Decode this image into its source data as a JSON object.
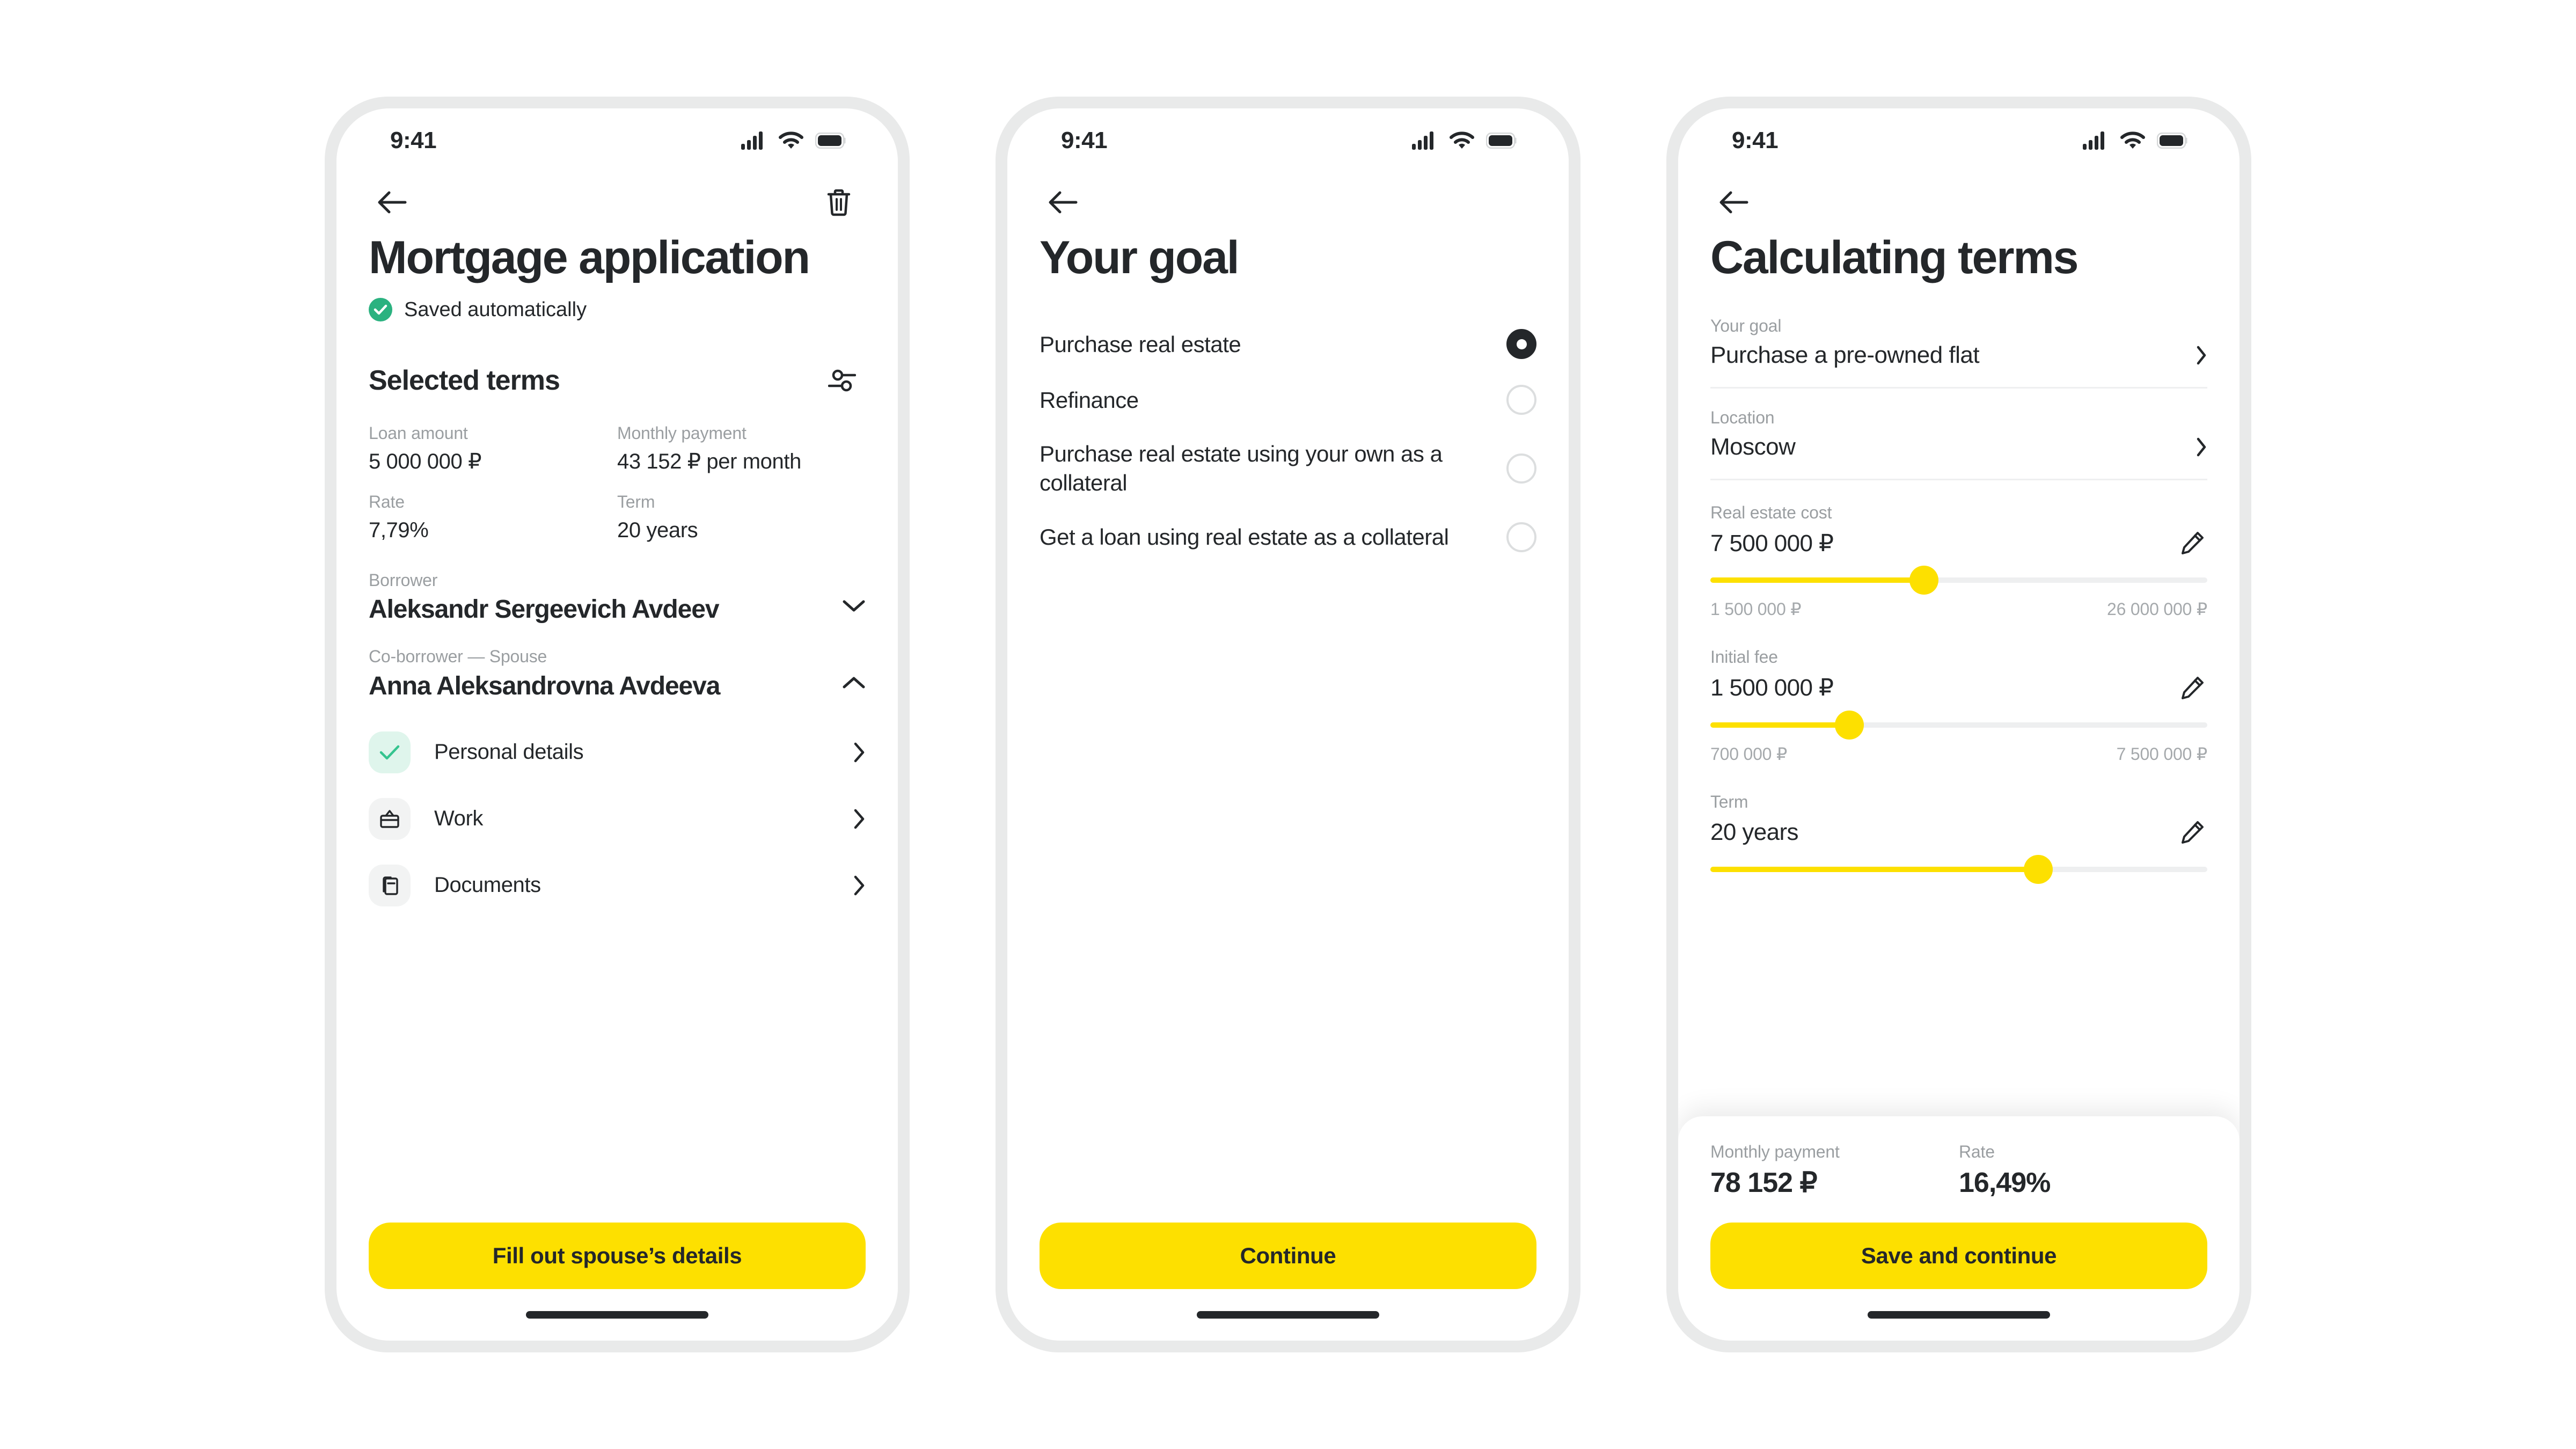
{
  "status_bar": {
    "time": "9:41",
    "icons": [
      "cellular-signal-icon",
      "wifi-icon",
      "battery-icon"
    ]
  },
  "colors": {
    "accent_yellow": "#FDE000",
    "text_dark": "#24272A",
    "text_muted": "#9A9EA1",
    "success_green": "#2BB280",
    "success_green_bg": "#DFF5EC",
    "divider": "#EEEFF0",
    "phone_frame": "#E9EAEA"
  },
  "screen1": {
    "title": "Mortgage application",
    "saved_text": "Saved automatically",
    "section_title": "Selected terms",
    "terms": [
      {
        "label": "Loan amount",
        "value": "5 000 000 ₽"
      },
      {
        "label": "Monthly payment",
        "value": "43 152 ₽ per month"
      },
      {
        "label": "Rate",
        "value": "7,79%"
      },
      {
        "label": "Term",
        "value": "20 years"
      }
    ],
    "borrower": {
      "label": "Borrower",
      "name": "Aleksandr Sergeevich Avdeev",
      "state": "collapsed"
    },
    "coborrower": {
      "label": "Co-borrower — Spouse",
      "name": "Anna Aleksandrovna Avdeeva",
      "state": "expanded"
    },
    "tasks": [
      {
        "label": "Personal details",
        "icon": "check-icon",
        "done": true
      },
      {
        "label": "Work",
        "icon": "briefcase-icon",
        "done": false
      },
      {
        "label": "Documents",
        "icon": "documents-icon",
        "done": false
      }
    ],
    "cta": "Fill out spouse’s details",
    "nav": {
      "back": "back-arrow-icon",
      "delete": "trash-icon",
      "filter": "sliders-icon"
    }
  },
  "screen2": {
    "title": "Your goal",
    "options": [
      {
        "label": "Purchase real estate",
        "selected": true
      },
      {
        "label": "Refinance",
        "selected": false
      },
      {
        "label": "Purchase real estate using your own as a collateral",
        "selected": false
      },
      {
        "label": "Get a loan using real estate as a collateral",
        "selected": false
      }
    ],
    "cta": "Continue"
  },
  "screen3": {
    "title": "Calculating terms",
    "fields": [
      {
        "label": "Your goal",
        "value": "Purchase a pre-owned flat",
        "action": "chevron-right-icon"
      },
      {
        "label": "Location",
        "value": "Moscow",
        "action": "chevron-right-icon"
      }
    ],
    "sliders": [
      {
        "label": "Real estate cost",
        "value": "7 500 000 ₽",
        "min_label": "1 500 000 ₽",
        "max_label": "26 000 000 ₽",
        "percent": 43,
        "action": "pencil-icon"
      },
      {
        "label": "Initial fee",
        "value": "1 500 000 ₽",
        "min_label": "700 000 ₽",
        "max_label": "7 500 000 ₽",
        "percent": 28,
        "action": "pencil-icon"
      },
      {
        "label": "Term",
        "value": "20 years",
        "min_label": "",
        "max_label": "",
        "percent": 66,
        "action": "pencil-icon"
      }
    ],
    "summary": [
      {
        "label": "Monthly payment",
        "value": "78 152 ₽"
      },
      {
        "label": "Rate",
        "value": "16,49%"
      }
    ],
    "cta": "Save and continue"
  }
}
